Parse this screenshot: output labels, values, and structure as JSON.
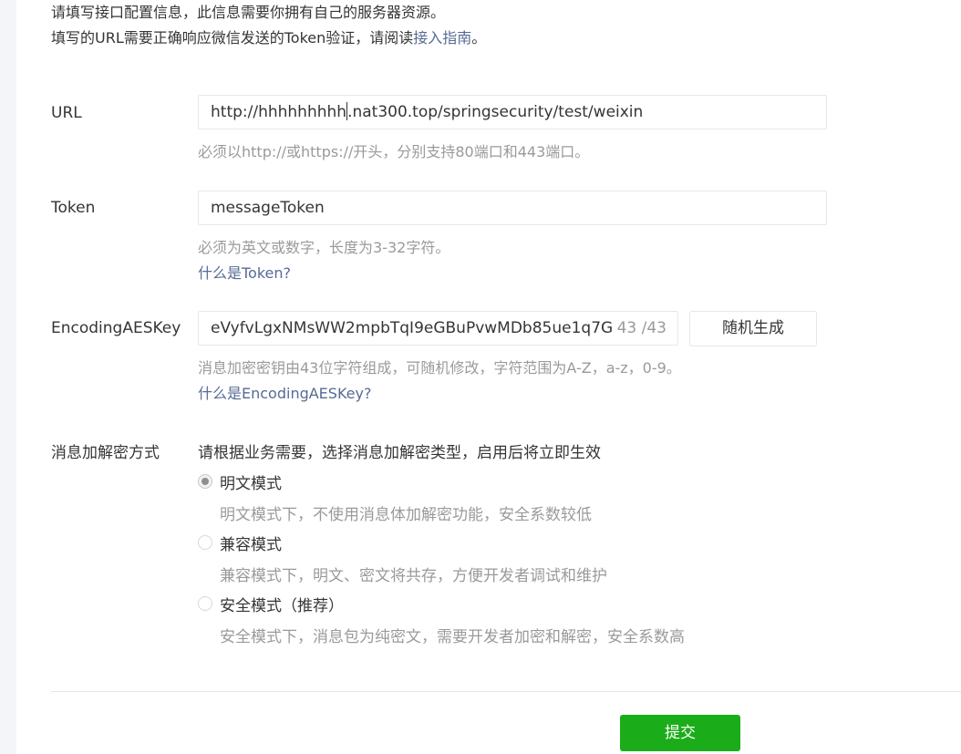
{
  "intro": {
    "line1": "请填写接口配置信息，此信息需要你拥有自己的服务器资源。",
    "line2_prefix": "填写的URL需要正确响应微信发送的Token验证，请阅读",
    "line2_link": "接入指南",
    "line2_suffix": "。"
  },
  "url": {
    "label": "URL",
    "value_before_caret": "http://hhhhhhhhh",
    "value_after_caret": ".nat300.top/springsecurity/test/weixin",
    "hint": "必须以http://或https://开头，分别支持80端口和443端口。"
  },
  "token": {
    "label": "Token",
    "value": "messageToken",
    "hint": "必须为英文或数字，长度为3-32字符。",
    "help_link": "什么是Token?"
  },
  "aes": {
    "label": "EncodingAESKey",
    "value": "eVyfvLgxNMsWW2mpbTqI9eGBuPvwMDb85ue1q7G",
    "counter": "43 /43",
    "generate_button": "随机生成",
    "hint": "消息加密密钥由43位字符组成，可随机修改，字符范围为A-Z，a-z，0-9。",
    "help_link": "什么是EncodingAESKey?"
  },
  "encryption": {
    "label": "消息加解密方式",
    "description": "请根据业务需要，选择消息加解密类型，启用后将立即生效",
    "options": [
      {
        "label": "明文模式",
        "desc": "明文模式下，不使用消息体加解密功能，安全系数较低",
        "checked": true
      },
      {
        "label": "兼容模式",
        "desc": "兼容模式下，明文、密文将共存，方便开发者调试和维护",
        "checked": false
      },
      {
        "label": "安全模式（推荐）",
        "desc": "安全模式下，消息包为纯密文，需要开发者加密和解密，安全系数高",
        "checked": false
      }
    ]
  },
  "submit_label": "提交",
  "colors": {
    "link": "#576b95",
    "primary": "#1aad19",
    "hint": "#9a9a9a"
  }
}
